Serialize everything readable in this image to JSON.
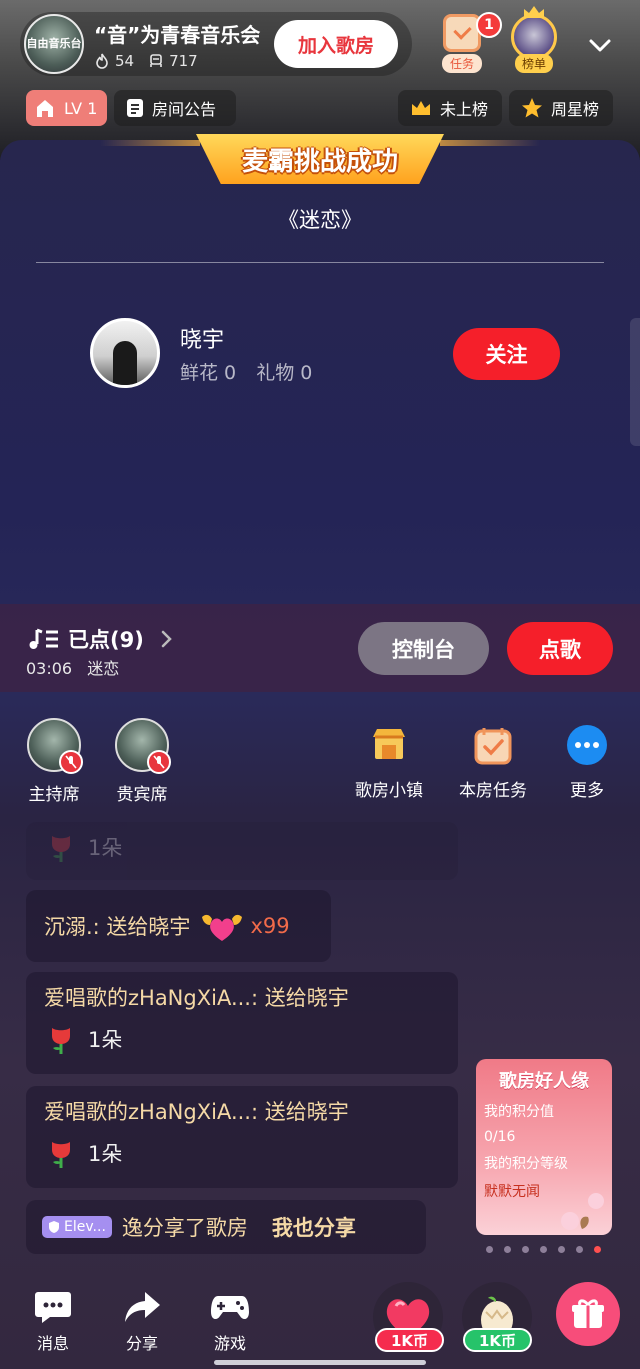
{
  "header": {
    "room_title": "“音”为青春音乐会",
    "avatar_text": "自由音乐台",
    "hot_count": "54",
    "member_count": "717",
    "join_label": "加入歌房",
    "task_label": "任务",
    "task_badge": "1",
    "rank_label": "榜单"
  },
  "pills": {
    "level": "LV 1",
    "notice": "房间公告",
    "not_ranked": "未上榜",
    "week_star": "周星榜"
  },
  "challenge": {
    "banner": "麦霸挑战成功",
    "song": "《迷恋》",
    "singer_name": "晓宇",
    "flowers": "鲜花 0",
    "gifts": "礼物 0",
    "follow_label": "关注"
  },
  "queue": {
    "title": "已点(9)",
    "time": "03:06",
    "current_song": "迷恋",
    "control_label": "控制台",
    "request_label": "点歌"
  },
  "seats": [
    {
      "label": "主持席"
    },
    {
      "label": "贵宾席"
    }
  ],
  "tools": [
    {
      "label": "歌房小镇",
      "icon": "shop-icon"
    },
    {
      "label": "本房任务",
      "icon": "task-icon"
    },
    {
      "label": "更多",
      "icon": "more-icon"
    }
  ],
  "chat": {
    "faded_count": "1朵",
    "msg1_text": "沉溺.: 送给晓宇",
    "msg1_count": "x99",
    "msg2_name": "爱唱歌的zHaNgXiA...: 送给晓宇",
    "msg2_count": "1朵",
    "msg3_name": "爱唱歌的zHaNgXiA...: 送给晓宇",
    "msg3_count": "1朵",
    "share_tag": "Elev...",
    "share_text": "逸分享了歌房",
    "share_action": "我也分享"
  },
  "promo": {
    "title": "歌房好人缘",
    "score_label": "我的积分值",
    "score_value": "0/16",
    "level_label": "我的积分等级",
    "level_value": "默默无闻",
    "page_count": 7,
    "active_page": 7
  },
  "bottom": {
    "message": "消息",
    "share": "分享",
    "game": "游戏",
    "coin1": "1K币",
    "coin2": "1K币"
  },
  "colors": {
    "accent_red": "#f51f2a",
    "gold_text": "#f5d9a6",
    "banner_orange": "#ffa21e"
  }
}
